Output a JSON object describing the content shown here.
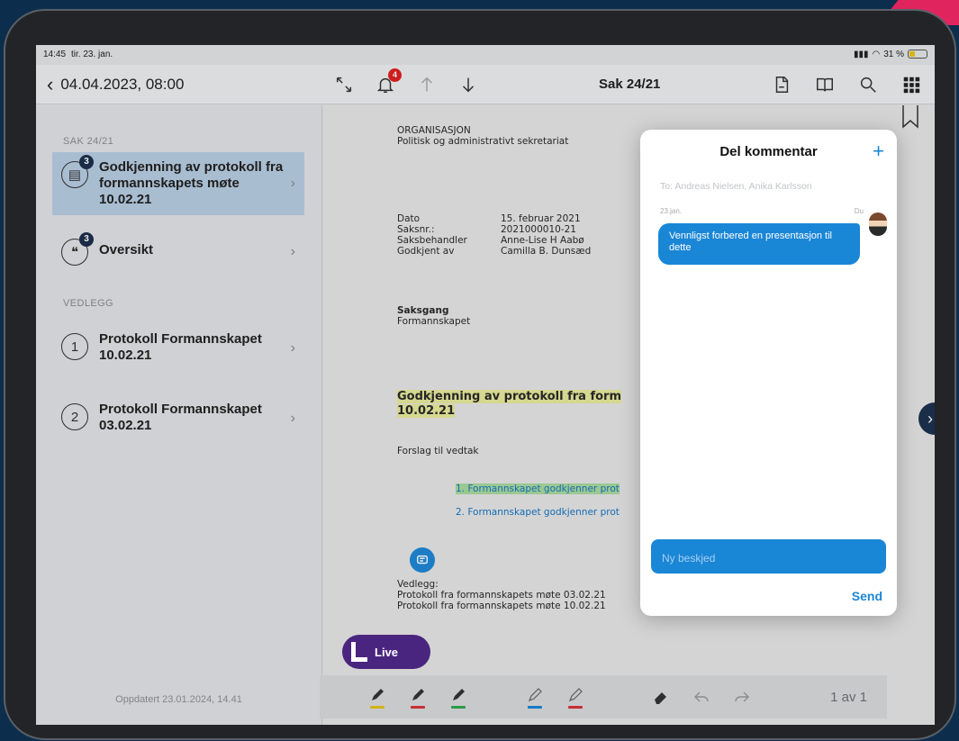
{
  "status_bar": {
    "time": "14:45",
    "date": "tir. 23. jan.",
    "battery": "31 %"
  },
  "navbar": {
    "back_label": "04.04.2023, 08:00",
    "title": "Sak 24/21",
    "bell_badge": "4"
  },
  "sidebar": {
    "section_case": "SAK 24/21",
    "section_attachments": "VEDLEGG",
    "items": [
      {
        "label": "Godkjenning av protokoll fra formannskapets møte 10.02.21",
        "badge": "3",
        "icon": "document-icon"
      },
      {
        "label": "Oversikt",
        "badge": "3",
        "icon": "comments-icon"
      },
      {
        "label": "Protokoll Formannskapet 10.02.21",
        "number": "1"
      },
      {
        "label": "Protokoll Formannskapet 03.02.21",
        "number": "2"
      }
    ],
    "updated": "Oppdatert 23.01.2024, 14.41"
  },
  "document": {
    "org": "ORGANISASJON",
    "org_sub": "Politisk og administrativt sekretariat",
    "meta": [
      {
        "key": "Dato",
        "value": "15. februar 2021"
      },
      {
        "key": "Saksnr.:",
        "value": "2021000010-21"
      },
      {
        "key": "Saksbehandler",
        "value": "Anne-Lise H Aabø"
      },
      {
        "key": "Godkjent av",
        "value": "Camilla B. Dunsæd"
      }
    ],
    "saksgang_label": "Saksgang",
    "saksgang_value": "Formannskapet",
    "heading": "Godkjenning av protokoll fra form",
    "heading_line2": "10.02.21",
    "proposal_label": "Forslag til vedtak",
    "list": [
      "1. Formannskapet godkjenner prot",
      "2. Formannskapet godkjenner prot"
    ],
    "vedlegg_label": "Vedlegg:",
    "vedlegg": [
      "Protokoll fra formannskapets møte 03.02.21",
      "Protokoll fra formannskapets møte 10.02.21"
    ]
  },
  "live_button": {
    "label": "Live"
  },
  "toolbar": {
    "page_counter": "1 av 1",
    "colors": {
      "yellow": "#e3c31b",
      "red": "#d6333a",
      "green": "#2fa84f",
      "blue": "#1a86d6"
    }
  },
  "popover": {
    "title": "Del kommentar",
    "to": "To: Andreas Nielsen, Anika Karlsson",
    "message_date": "23.jan.",
    "message_author": "Du",
    "message": "Vennligst forbered en presentasjon til dette",
    "new_message_placeholder": "Ny beskjed",
    "send_label": "Send"
  }
}
